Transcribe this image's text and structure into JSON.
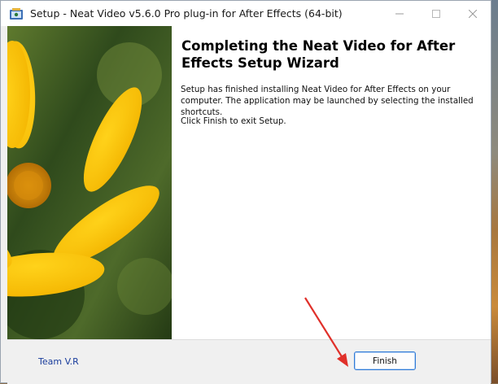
{
  "window": {
    "title": "Setup - Neat Video v5.6.0 Pro plug-in for After Effects (64-bit)",
    "controls": {
      "minimize": "minimize-icon",
      "maximize": "maximize-icon",
      "close": "close-icon"
    }
  },
  "banner": {
    "image": "yellow-flower-image"
  },
  "main": {
    "heading": "Completing the Neat Video for After Effects Setup Wizard",
    "paragraph1": "Setup has finished installing Neat Video for After Effects on your computer. The application may be launched by selecting the installed shortcuts.",
    "paragraph2": "Click Finish to exit Setup."
  },
  "footer": {
    "branding": "Team V.R",
    "finish_label": "Finish"
  },
  "colors": {
    "accent": "#2f7ad6",
    "branding_text": "#1a3d9c",
    "annotation_arrow": "#e0302a"
  }
}
